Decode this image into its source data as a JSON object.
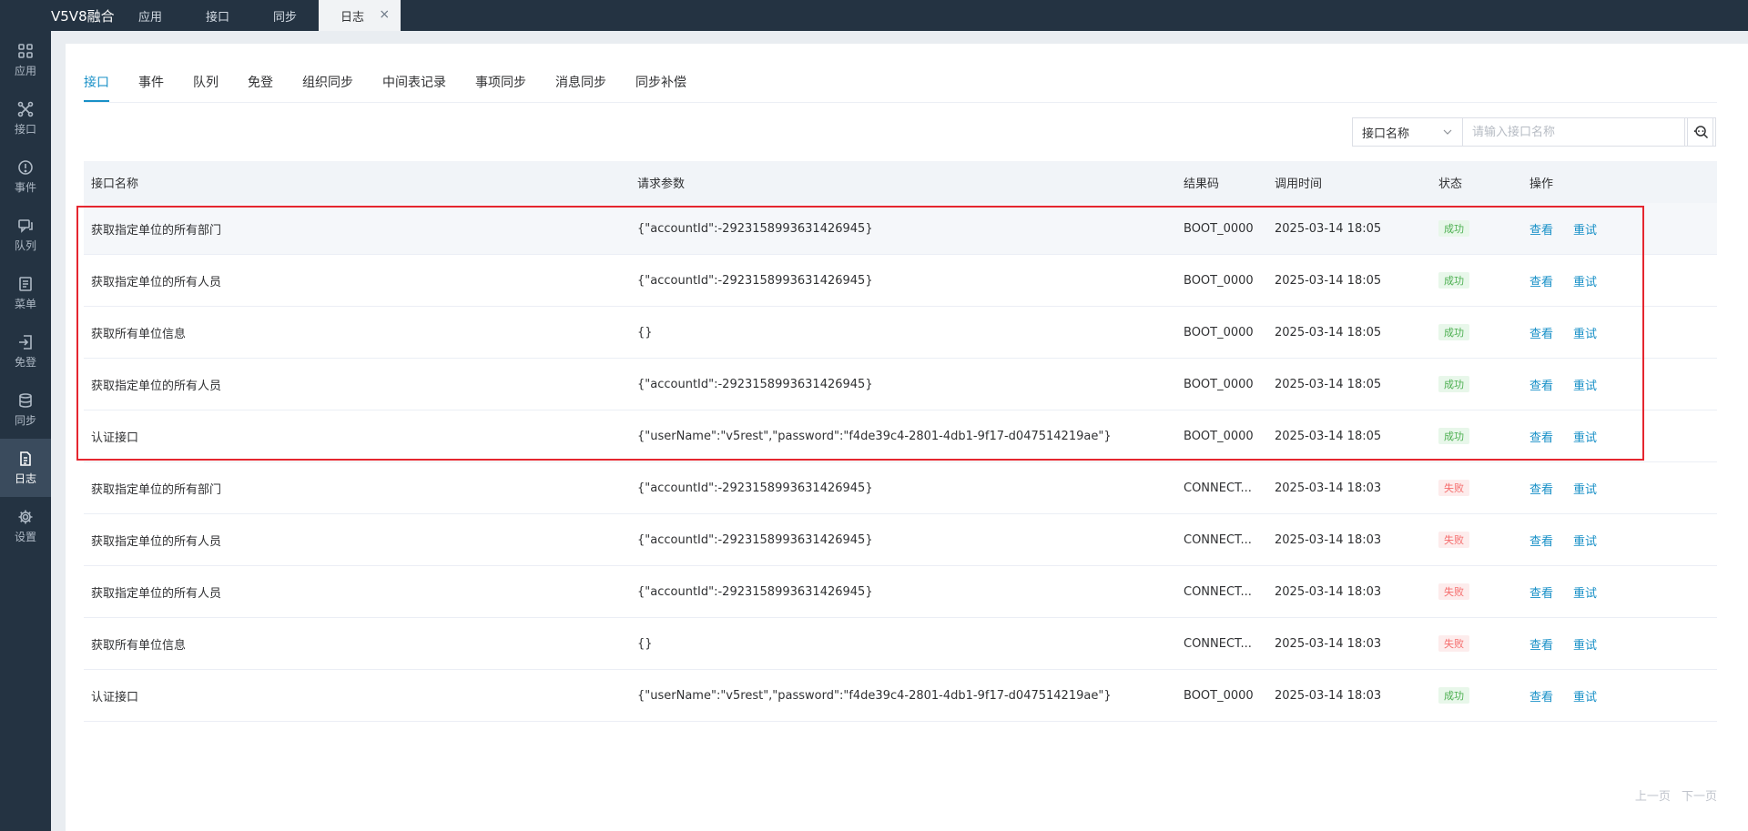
{
  "app": {
    "title": "V5V8融合"
  },
  "top_tabs": [
    {
      "label": "应用"
    },
    {
      "label": "接口"
    },
    {
      "label": "同步"
    },
    {
      "label": "日志",
      "active": true,
      "close": "×"
    }
  ],
  "sidebar": {
    "items": [
      {
        "label": "应用",
        "icon": "grid-icon"
      },
      {
        "label": "接口",
        "icon": "network-icon"
      },
      {
        "label": "事件",
        "icon": "alert-icon"
      },
      {
        "label": "队列",
        "icon": "chat-icon"
      },
      {
        "label": "菜单",
        "icon": "document-icon"
      },
      {
        "label": "免登",
        "icon": "login-icon"
      },
      {
        "label": "同步",
        "icon": "database-icon"
      },
      {
        "label": "日志",
        "icon": "file-icon",
        "active": true
      },
      {
        "label": "设置",
        "icon": "gear-icon"
      }
    ]
  },
  "subtabs": [
    {
      "label": "接口",
      "active": true
    },
    {
      "label": "事件"
    },
    {
      "label": "队列"
    },
    {
      "label": "免登"
    },
    {
      "label": "组织同步"
    },
    {
      "label": "中间表记录"
    },
    {
      "label": "事项同步"
    },
    {
      "label": "消息同步"
    },
    {
      "label": "同步补偿"
    }
  ],
  "search": {
    "field": "接口名称",
    "placeholder": "请输入接口名称",
    "more": "···"
  },
  "table": {
    "headers": [
      "接口名称",
      "请求参数",
      "结果码",
      "调用时间",
      "状态",
      "操作"
    ],
    "rows": [
      {
        "name": "获取指定单位的所有部门",
        "params": "{\"accountId\":-2923158993631426945}",
        "code": "BOOT_0000",
        "time": "2025-03-14 18:05",
        "status": "成功",
        "ok": true
      },
      {
        "name": "获取指定单位的所有人员",
        "params": "{\"accountId\":-2923158993631426945}",
        "code": "BOOT_0000",
        "time": "2025-03-14 18:05",
        "status": "成功",
        "ok": true
      },
      {
        "name": "获取所有单位信息",
        "params": "{}",
        "code": "BOOT_0000",
        "time": "2025-03-14 18:05",
        "status": "成功",
        "ok": true
      },
      {
        "name": "获取指定单位的所有人员",
        "params": "{\"accountId\":-2923158993631426945}",
        "code": "BOOT_0000",
        "time": "2025-03-14 18:05",
        "status": "成功",
        "ok": true
      },
      {
        "name": "认证接口",
        "params": "{\"userName\":\"v5rest\",\"password\":\"f4de39c4-2801-4db1-9f17-d047514219ae\"}",
        "code": "BOOT_0000",
        "time": "2025-03-14 18:05",
        "status": "成功",
        "ok": true
      },
      {
        "name": "获取指定单位的所有部门",
        "params": "{\"accountId\":-2923158993631426945}",
        "code": "CONNECT...",
        "time": "2025-03-14 18:03",
        "status": "失败",
        "ok": false
      },
      {
        "name": "获取指定单位的所有人员",
        "params": "{\"accountId\":-2923158993631426945}",
        "code": "CONNECT...",
        "time": "2025-03-14 18:03",
        "status": "失败",
        "ok": false
      },
      {
        "name": "获取指定单位的所有人员",
        "params": "{\"accountId\":-2923158993631426945}",
        "code": "CONNECT...",
        "time": "2025-03-14 18:03",
        "status": "失败",
        "ok": false
      },
      {
        "name": "获取所有单位信息",
        "params": "{}",
        "code": "CONNECT...",
        "time": "2025-03-14 18:03",
        "status": "失败",
        "ok": false
      },
      {
        "name": "认证接口",
        "params": "{\"userName\":\"v5rest\",\"password\":\"f4de39c4-2801-4db1-9f17-d047514219ae\"}",
        "code": "BOOT_0000",
        "time": "2025-03-14 18:03",
        "status": "成功",
        "ok": true
      }
    ],
    "actions": {
      "view": "查看",
      "retry": "重试"
    }
  },
  "pager": {
    "prev": "上一页",
    "next": "下一页"
  },
  "colors": {
    "accent": "#1890c7",
    "sidebar_bg": "#243342",
    "success": "#4caf50",
    "fail": "#f56c6c",
    "highlight": "#e5262f"
  }
}
